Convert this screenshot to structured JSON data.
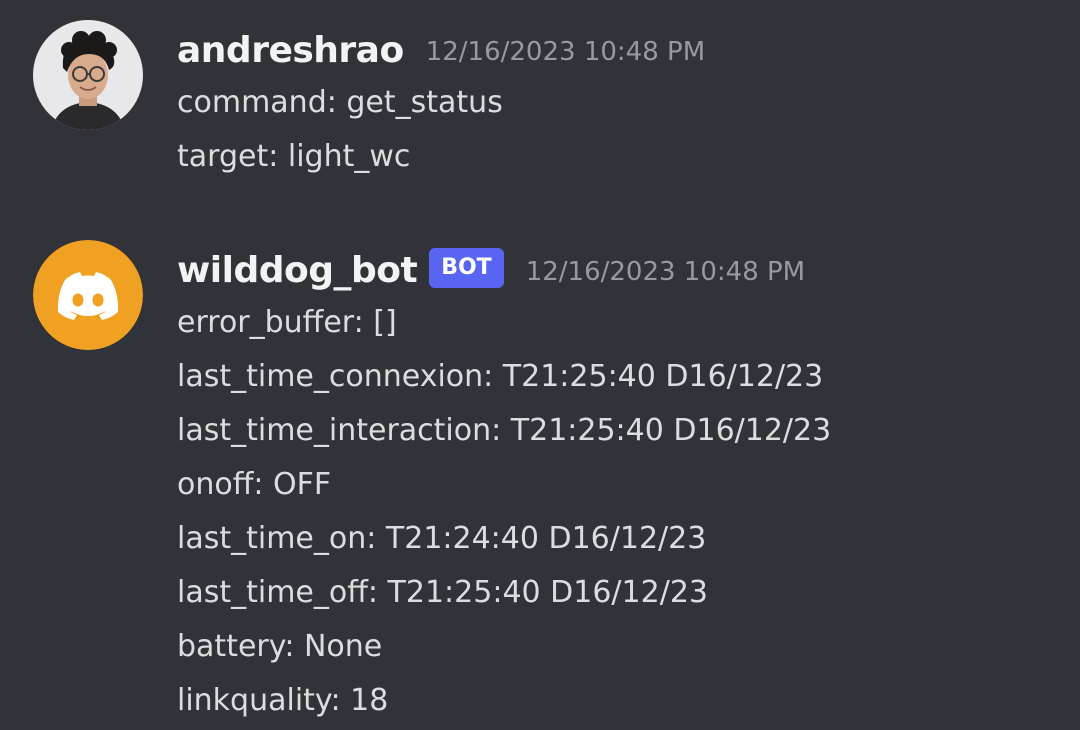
{
  "messages": {
    "user": {
      "username": "andreshrao",
      "timestamp": "12/16/2023 10:48 PM",
      "lines": [
        "command: get_status",
        "target: light_wc"
      ]
    },
    "bot": {
      "username": "wilddog_bot",
      "badge": "BOT",
      "timestamp": "12/16/2023 10:48 PM",
      "avatar_icon": "discord-logo-icon",
      "lines": [
        "error_buffer: []",
        "last_time_connexion: T21:25:40 D16/12/23",
        "last_time_interaction: T21:25:40 D16/12/23",
        "onoff: OFF",
        "last_time_on: T21:24:40 D16/12/23",
        "last_time_off: T21:25:40 D16/12/23",
        "battery: None",
        "linkquality: 18"
      ]
    }
  },
  "colors": {
    "background": "#313338",
    "username": "#f2f3f5",
    "text": "#dbdee1",
    "timestamp": "#949ba4",
    "bot_badge": "#5865f2",
    "bot_avatar": "#f0a121"
  }
}
